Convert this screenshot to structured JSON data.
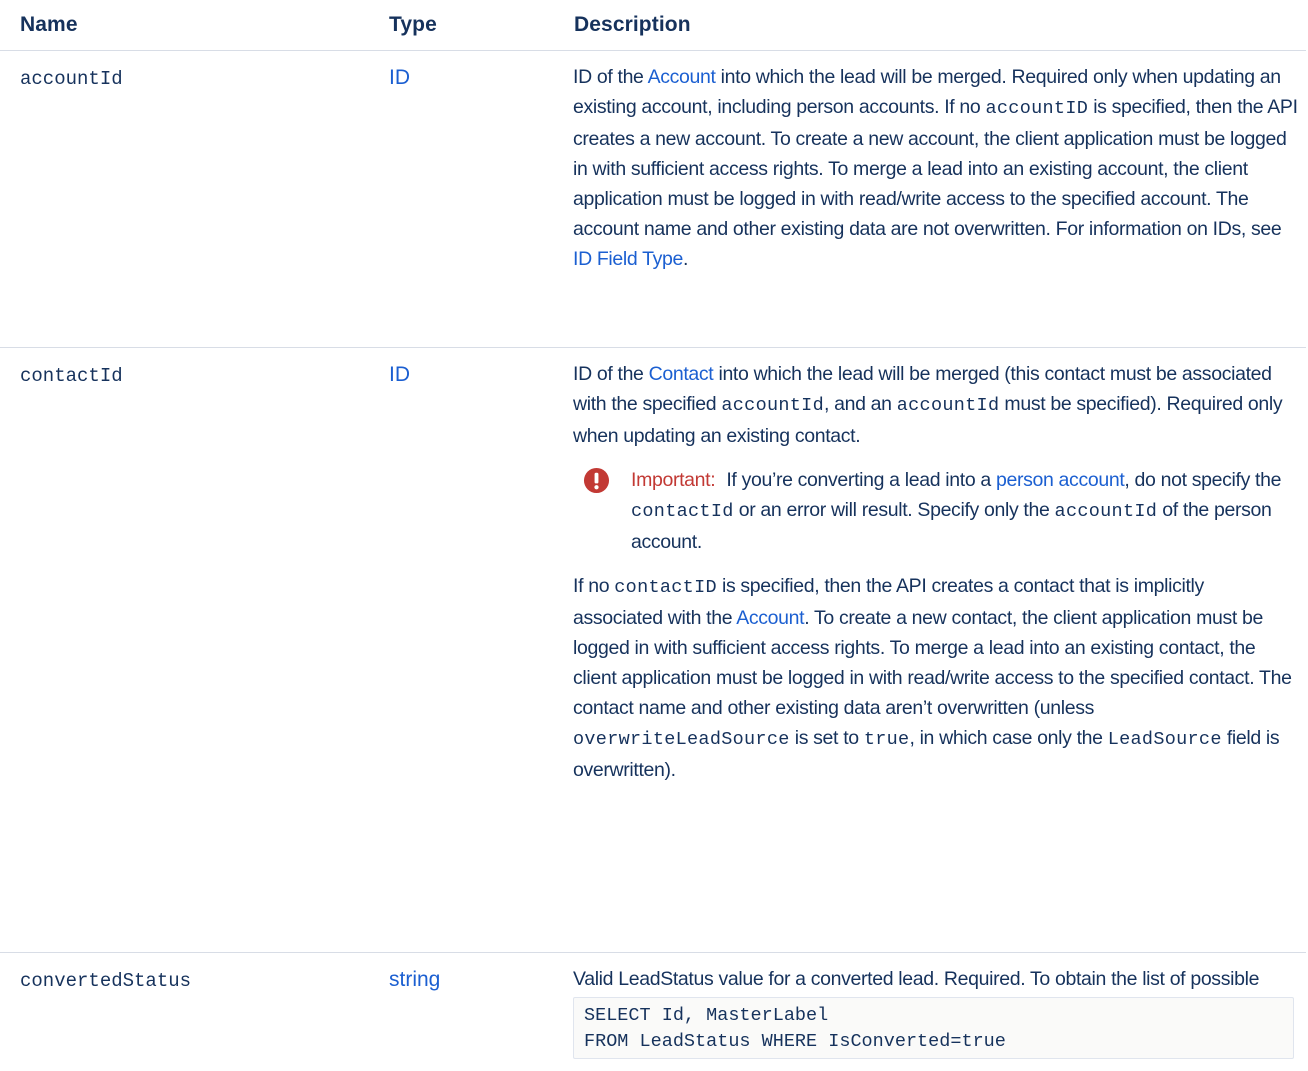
{
  "columns": {
    "name": "Name",
    "type": "Type",
    "description": "Description"
  },
  "rows": [
    {
      "name": "accountId",
      "type": "ID",
      "desc": {
        "t1": "ID of the ",
        "link1": "Account",
        "t2": " into which the lead will be merged. Required only when updating an existing account, including person accounts. If no ",
        "code1": "accountID",
        "t3": " is specified, then the API creates a new account. To create a new account, the client application must be logged in with sufficient access rights. To merge a lead into an existing account, the client application must be logged in with read/write access to the specified account. The account name and other existing data are not overwritten. For information on IDs, see ",
        "link2": "ID Field Type",
        "t4": "."
      }
    },
    {
      "name": "contactId",
      "type": "ID",
      "desc": {
        "t1": "ID of the ",
        "link1": "Contact",
        "t2": " into which the lead will be merged (this contact must be associated with the specified ",
        "code1": "accountId",
        "t3": ", and an ",
        "code2": "accountId",
        "t4": " must be specified). Required only when updating an existing contact.",
        "note": {
          "label": "Important:",
          "t1": " If you’re converting a lead into a ",
          "link": "person account",
          "t2": ", do not specify the ",
          "code1": "contactId",
          "t3": " or an error will result. Specify only the ",
          "code2": "accountId",
          "t4": " of the person account."
        },
        "p2": {
          "t1": "If no ",
          "code1": "contactID",
          "t2": " is specified, then the API creates a contact that is implicitly associated with the ",
          "link": "Account",
          "t3": ". To create a new contact, the client application must be logged in with sufficient access rights. To merge a lead into an existing contact, the client application must be logged in with read/write access to the specified contact. The contact name and other existing data aren’t overwritten (unless ",
          "code2": "overwriteLeadSource",
          "t4": " is set to ",
          "code3": "true",
          "t5": ", in which case only the ",
          "code4": "LeadSource",
          "t6": " field is overwritten)."
        }
      }
    },
    {
      "name": "convertedStatus",
      "type": "string",
      "desc": {
        "t1": "Valid LeadStatus value for a converted lead. Required. To obtain the list of possible values, the client application queries the LeadStatus object. For example:",
        "code_lines": [
          "SELECT Id, MasterLabel",
          "FROM LeadStatus WHERE IsConverted=true"
        ]
      }
    }
  ],
  "colors": {
    "text": "#16325c",
    "link": "#1b5fd1",
    "important": "#c23934",
    "border": "#d8dde6"
  }
}
